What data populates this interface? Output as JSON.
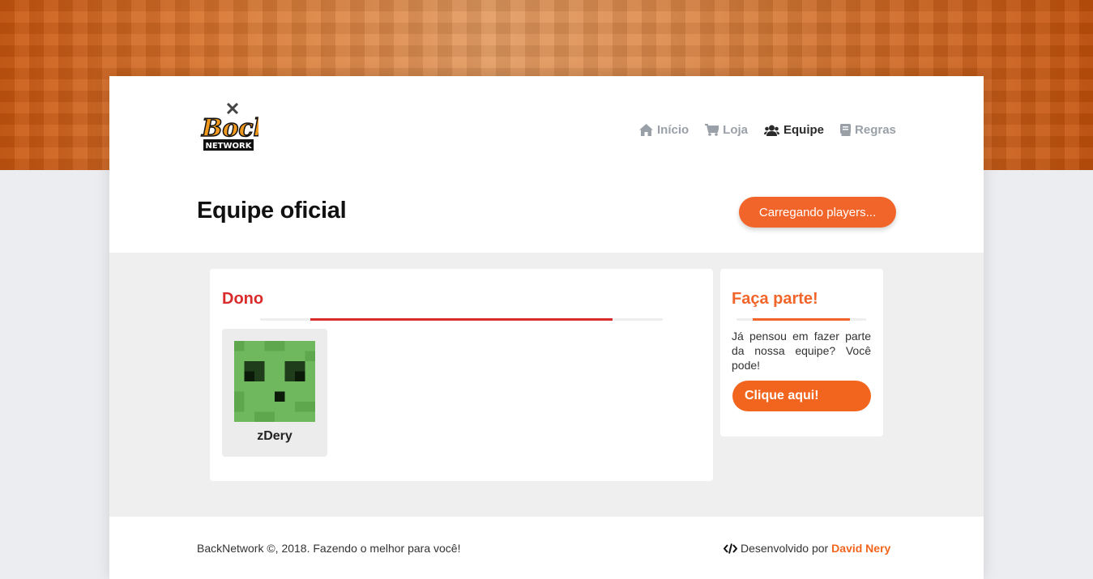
{
  "nav": {
    "items": [
      {
        "label": "Início",
        "icon": "home-icon"
      },
      {
        "label": "Loja",
        "icon": "cart-icon"
      },
      {
        "label": "Equipe",
        "icon": "users-icon",
        "active": true
      },
      {
        "label": "Regras",
        "icon": "book-icon"
      }
    ]
  },
  "page": {
    "title": "Equipe oficial",
    "loading_button": "Carregando players..."
  },
  "team": {
    "section_title": "Dono",
    "members": [
      {
        "name": "zDery"
      }
    ]
  },
  "sidebar": {
    "title": "Faça parte!",
    "text": "Já pensou em fazer parte da nossa equipe? Você pode!",
    "button": "Clique aqui!"
  },
  "footer": {
    "copyright": "BackNetwork ©, 2018. Fazendo o melhor para você!",
    "dev_prefix": "Desenvolvido por",
    "dev_name": "David Nery"
  },
  "colors": {
    "accent": "#f2652a",
    "owner": "#d92b2b"
  }
}
